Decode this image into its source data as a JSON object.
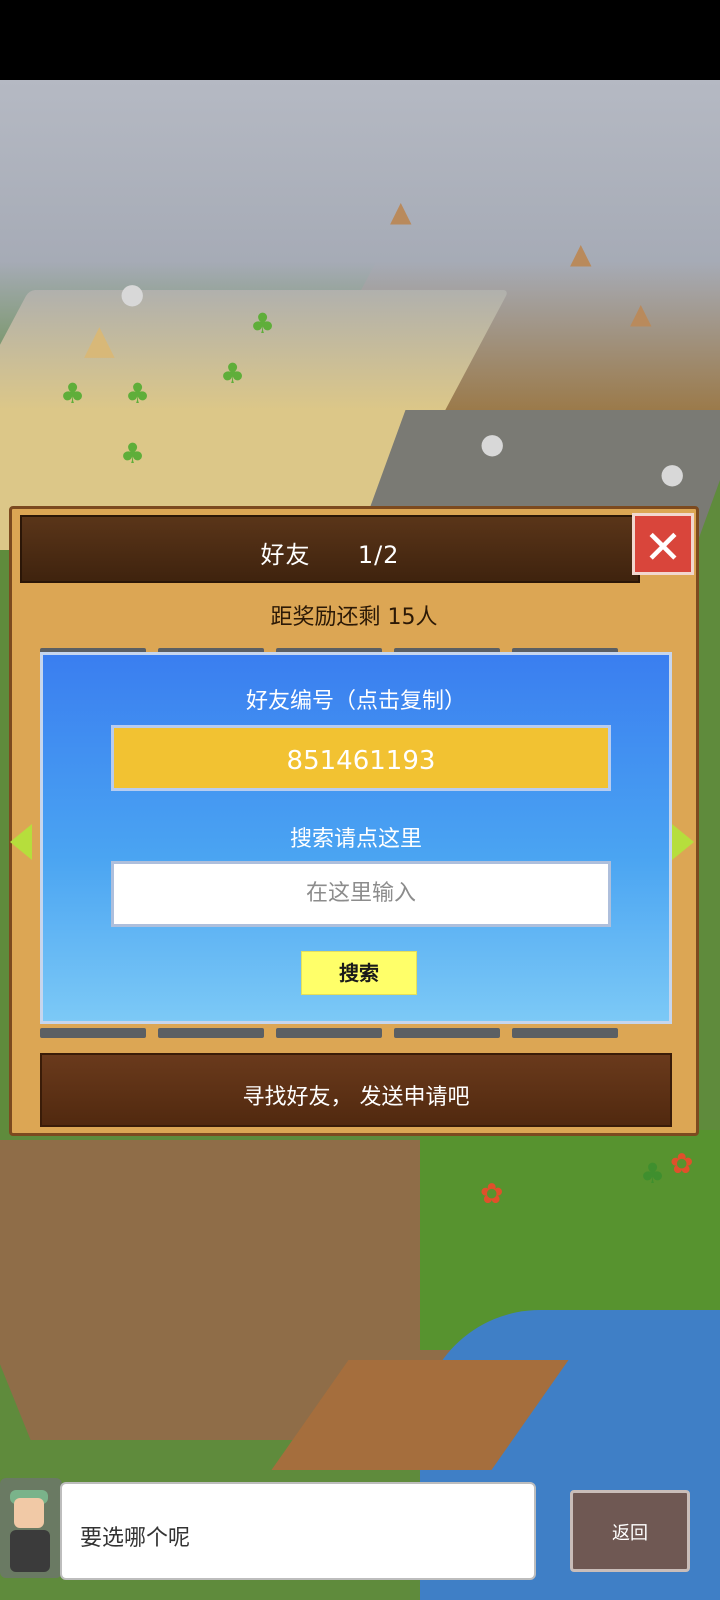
{
  "panel": {
    "title": "好友",
    "page": "1/2",
    "reward_text": "距奖励还剩 15人",
    "friend_id_label": "好友编号（点击复制）",
    "friend_id_value": "851461193",
    "search_hint": "搜索请点这里",
    "search_placeholder": "在这里输入",
    "search_button": "搜索",
    "find_text": "寻找好友， 发送申请吧"
  },
  "dialog": {
    "text": "要选哪个呢"
  },
  "back_button": "返回",
  "icons": {
    "close": "close-icon",
    "prev": "arrow-left-icon",
    "next": "arrow-right-icon"
  },
  "colors": {
    "accent_yellow": "#f2c232",
    "close_red": "#d9453b",
    "panel": "#dca654"
  }
}
